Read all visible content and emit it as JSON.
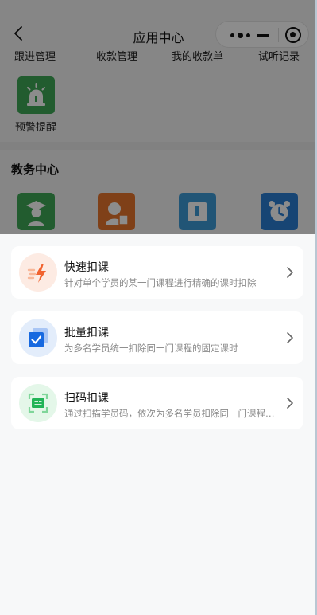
{
  "navbar": {
    "title": "应用中心"
  },
  "top_row": {
    "items": [
      "跟进管理",
      "收款管理",
      "我的收款单",
      "试听记录"
    ]
  },
  "warning_app": {
    "label": "预警提醒"
  },
  "section": {
    "title": "教务中心"
  },
  "colors": {
    "warning_tile": "#3fa857",
    "edu_tile_1": "#3fa857",
    "edu_tile_2": "#e8762d",
    "edu_tile_3": "#3c9bd8",
    "edu_tile_4": "#2b7fd4",
    "quick_icon_bg": "#fdebe3",
    "batch_icon_bg": "#e3edfb",
    "scan_icon_bg": "#e4f7e9"
  },
  "icons": {
    "back": "chevron-left-icon",
    "warning": "siren-icon",
    "quick": "lightning-icon",
    "batch": "checkbox-stack-icon",
    "scan": "scan-frame-icon",
    "arrow": "chevron-right-icon"
  },
  "options": [
    {
      "title": "快速扣课",
      "desc": "针对单个学员的某一门课程进行精确的课时扣除"
    },
    {
      "title": "批量扣课",
      "desc": "为多名学员统一扣除同一门课程的固定课时"
    },
    {
      "title": "扫码扣课",
      "desc": "通过扫描学员码，依次为多名学员扣除同一门课程的课时"
    }
  ]
}
